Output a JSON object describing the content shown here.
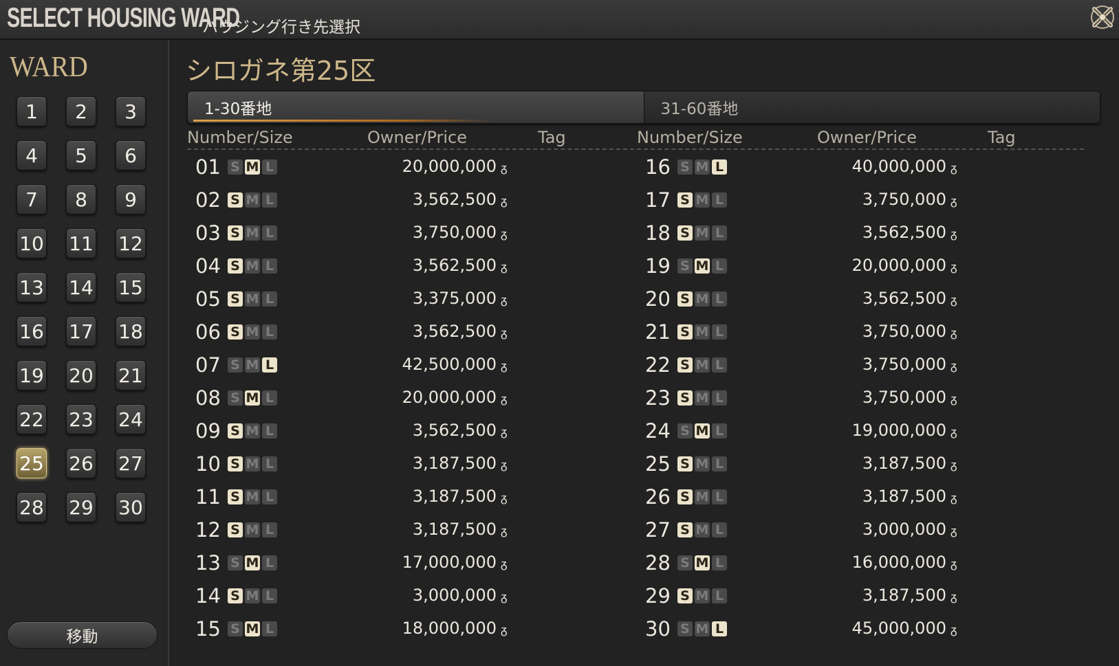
{
  "header": {
    "title": "SELECT HOUSING WARD",
    "subtitle": "ハウジング行き先選択",
    "close_icon": "close-x-icon"
  },
  "sidebar": {
    "heading": "WARD",
    "selected_ward": "25",
    "wards": [
      "1",
      "2",
      "3",
      "4",
      "5",
      "6",
      "7",
      "8",
      "9",
      "10",
      "11",
      "12",
      "13",
      "14",
      "15",
      "16",
      "17",
      "18",
      "19",
      "20",
      "21",
      "22",
      "23",
      "24",
      "25",
      "26",
      "27",
      "28",
      "29",
      "30"
    ],
    "move_label": "移動"
  },
  "main": {
    "district_title": "シロガネ第25区",
    "tabs": [
      {
        "label": "1-30番地",
        "active": true
      },
      {
        "label": "31-60番地",
        "active": false
      }
    ],
    "columns": {
      "number_size": "Number/Size",
      "owner_price": "Owner/Price",
      "tag": "Tag"
    },
    "currency_symbol": "ᵹ",
    "size_letters": [
      "S",
      "M",
      "L"
    ],
    "left_rows": [
      {
        "num": "01",
        "size": "M",
        "price": "20,000,000"
      },
      {
        "num": "02",
        "size": "S",
        "price": "3,562,500"
      },
      {
        "num": "03",
        "size": "S",
        "price": "3,750,000"
      },
      {
        "num": "04",
        "size": "S",
        "price": "3,562,500"
      },
      {
        "num": "05",
        "size": "S",
        "price": "3,375,000"
      },
      {
        "num": "06",
        "size": "S",
        "price": "3,562,500"
      },
      {
        "num": "07",
        "size": "L",
        "price": "42,500,000"
      },
      {
        "num": "08",
        "size": "M",
        "price": "20,000,000"
      },
      {
        "num": "09",
        "size": "S",
        "price": "3,562,500"
      },
      {
        "num": "10",
        "size": "S",
        "price": "3,187,500"
      },
      {
        "num": "11",
        "size": "S",
        "price": "3,187,500"
      },
      {
        "num": "12",
        "size": "S",
        "price": "3,187,500"
      },
      {
        "num": "13",
        "size": "M",
        "price": "17,000,000"
      },
      {
        "num": "14",
        "size": "S",
        "price": "3,000,000"
      },
      {
        "num": "15",
        "size": "M",
        "price": "18,000,000"
      }
    ],
    "right_rows": [
      {
        "num": "16",
        "size": "L",
        "price": "40,000,000"
      },
      {
        "num": "17",
        "size": "S",
        "price": "3,750,000"
      },
      {
        "num": "18",
        "size": "S",
        "price": "3,562,500"
      },
      {
        "num": "19",
        "size": "M",
        "price": "20,000,000"
      },
      {
        "num": "20",
        "size": "S",
        "price": "3,562,500"
      },
      {
        "num": "21",
        "size": "S",
        "price": "3,750,000"
      },
      {
        "num": "22",
        "size": "S",
        "price": "3,750,000"
      },
      {
        "num": "23",
        "size": "S",
        "price": "3,750,000"
      },
      {
        "num": "24",
        "size": "M",
        "price": "19,000,000"
      },
      {
        "num": "25",
        "size": "S",
        "price": "3,187,500"
      },
      {
        "num": "26",
        "size": "S",
        "price": "3,187,500"
      },
      {
        "num": "27",
        "size": "S",
        "price": "3,000,000"
      },
      {
        "num": "28",
        "size": "M",
        "price": "16,000,000"
      },
      {
        "num": "29",
        "size": "S",
        "price": "3,187,500"
      },
      {
        "num": "30",
        "size": "L",
        "price": "45,000,000"
      }
    ]
  },
  "colors": {
    "accent_gold": "#cdb78a",
    "size_active": "#ece3cb",
    "background": "#222222"
  }
}
